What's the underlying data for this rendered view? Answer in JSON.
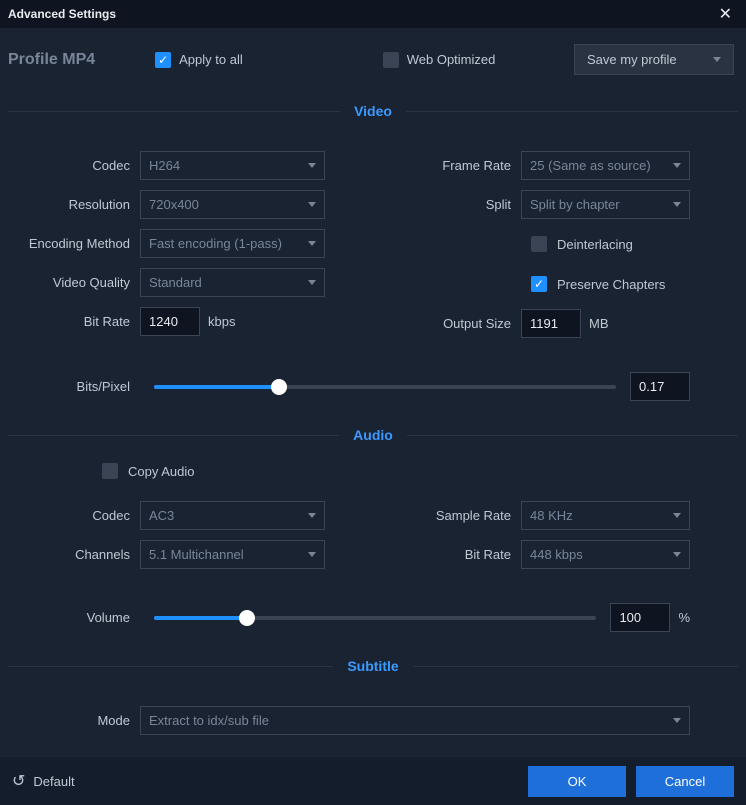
{
  "titlebar": {
    "title": "Advanced Settings"
  },
  "header": {
    "profile_label": "Profile  MP4",
    "apply_all_label": "Apply to all",
    "web_opt_label": "Web Optimized",
    "save_profile_label": "Save my profile"
  },
  "sections": {
    "video": "Video",
    "audio": "Audio",
    "subtitle": "Subtitle"
  },
  "video": {
    "codec_label": "Codec",
    "codec_value": "H264",
    "resolution_label": "Resolution",
    "resolution_value": "720x400",
    "encoding_label": "Encoding Method",
    "encoding_value": "Fast encoding (1-pass)",
    "quality_label": "Video Quality",
    "quality_value": "Standard",
    "bitrate_label": "Bit Rate",
    "bitrate_value": "1240",
    "bitrate_unit": "kbps",
    "framerate_label": "Frame Rate",
    "framerate_value": "25 (Same as source)",
    "split_label": "Split",
    "split_value": "Split by chapter",
    "deint_label": "Deinterlacing",
    "preserve_label": "Preserve Chapters",
    "output_label": "Output Size",
    "output_value": "1191",
    "output_unit": "MB",
    "bpp_label": "Bits/Pixel",
    "bpp_value": "0.17"
  },
  "audio": {
    "copy_label": "Copy Audio",
    "codec_label": "Codec",
    "codec_value": "AC3",
    "channels_label": "Channels",
    "channels_value": "5.1 Multichannel",
    "sample_label": "Sample Rate",
    "sample_value": "48 KHz",
    "bitrate_label": "Bit Rate",
    "bitrate_value": "448 kbps",
    "volume_label": "Volume",
    "volume_value": "100",
    "volume_unit": "%"
  },
  "subtitle": {
    "mode_label": "Mode",
    "mode_value": "Extract to idx/sub file"
  },
  "footer": {
    "default_label": "Default",
    "ok_label": "OK",
    "cancel_label": "Cancel"
  }
}
